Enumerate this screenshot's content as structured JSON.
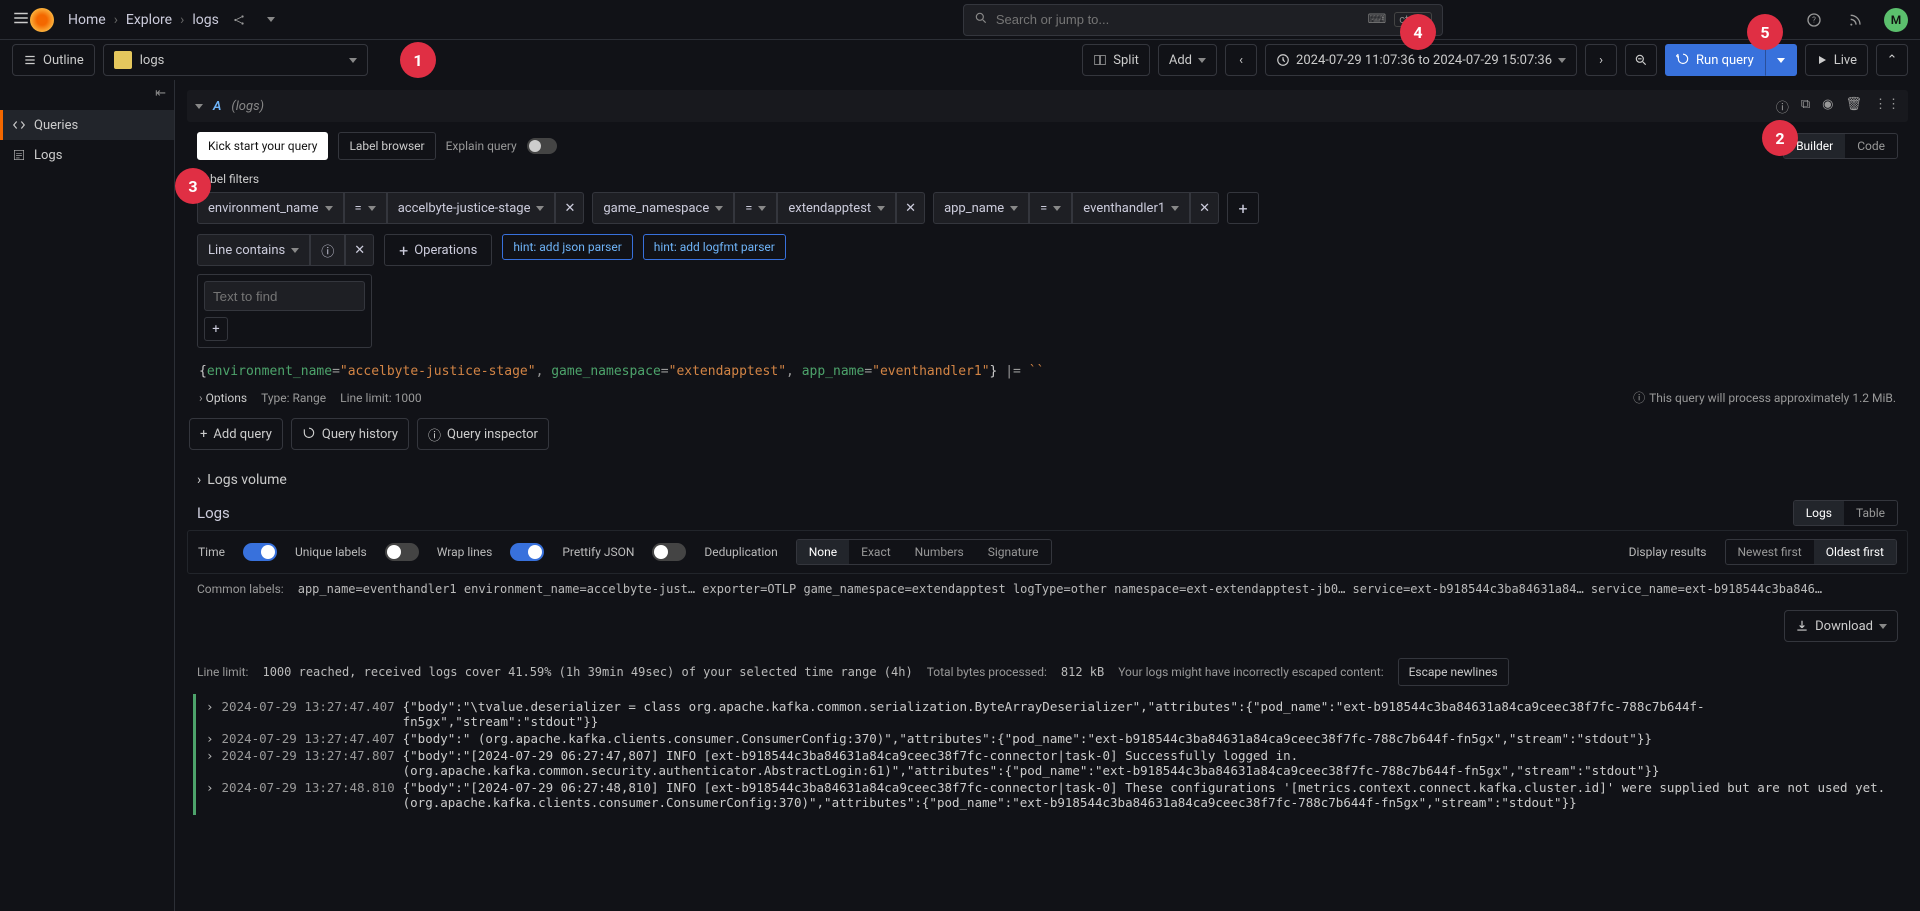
{
  "topnav": {
    "crumbs": [
      "Home",
      "Explore",
      "logs"
    ],
    "search_placeholder": "Search or jump to...",
    "kbd_hint": "ctrl+k",
    "avatar_initial": "M"
  },
  "toolbar": {
    "outline": "Outline",
    "datasource": "logs",
    "split": "Split",
    "add": "Add",
    "time_range": "2024-07-29 11:07:36 to 2024-07-29 15:07:36",
    "run": "Run query",
    "live": "Live"
  },
  "badges": {
    "b1": "1",
    "b2": "2",
    "b3": "3",
    "b4": "4",
    "b5": "5"
  },
  "sidebar": {
    "items": [
      "Queries",
      "Logs"
    ]
  },
  "query": {
    "letter": "A",
    "ds": "(logs)",
    "kick": "Kick start your query",
    "label_browser": "Label browser",
    "explain": "Explain query",
    "builder": "Builder",
    "code": "Code",
    "label_filters_title": "Label filters",
    "filters": [
      {
        "key": "environment_name",
        "op": "=",
        "val": "accelbyte-justice-stage"
      },
      {
        "key": "game_namespace",
        "op": "=",
        "val": "extendapptest"
      },
      {
        "key": "app_name",
        "op": "=",
        "val": "eventhandler1"
      }
    ],
    "line_contains": "Line contains",
    "text_to_find_ph": "Text to find",
    "operations": "Operations",
    "hint_json": "hint: add json parser",
    "hint_logfmt": "hint: add logfmt parser",
    "expr_parts": [
      {
        "t": "br",
        "v": "{"
      },
      {
        "t": "k",
        "v": "environment_name"
      },
      {
        "t": "op",
        "v": "="
      },
      {
        "t": "v",
        "v": "\"accelbyte-justice-stage\""
      },
      {
        "t": "op",
        "v": ", "
      },
      {
        "t": "k",
        "v": "game_namespace"
      },
      {
        "t": "op",
        "v": "="
      },
      {
        "t": "v",
        "v": "\"extendapptest\""
      },
      {
        "t": "op",
        "v": ", "
      },
      {
        "t": "k",
        "v": "app_name"
      },
      {
        "t": "op",
        "v": "="
      },
      {
        "t": "v",
        "v": "\"eventhandler1\""
      },
      {
        "t": "br",
        "v": "}"
      },
      {
        "t": "op",
        "v": " |= "
      },
      {
        "t": "v",
        "v": "``"
      }
    ],
    "options": "Options",
    "type": "Type: Range",
    "line_limit": "Line limit: 1000",
    "cost": "This query will process approximately 1.2 MiB.",
    "add_query": "Add query",
    "history": "Query history",
    "inspector": "Query inspector"
  },
  "results": {
    "volume": "Logs volume",
    "logs_title": "Logs",
    "tabs": {
      "logs": "Logs",
      "table": "Table"
    },
    "ctrl": {
      "time": "Time",
      "unique": "Unique labels",
      "wrap": "Wrap lines",
      "pretty": "Prettify JSON",
      "dedup": "Deduplication",
      "none": "None",
      "exact": "Exact",
      "numbers": "Numbers",
      "sig": "Signature",
      "display": "Display results",
      "newest": "Newest first",
      "oldest": "Oldest first"
    },
    "common_labels_lbl": "Common labels:",
    "common_labels": "app_name=eventhandler1  environment_name=accelbyte-just…  exporter=OTLP  game_namespace=extendapptest  logType=other  namespace=ext-extendapptest-jb0…  service=ext-b918544c3ba84631a84…  service_name=ext-b918544c3ba846…",
    "download": "Download",
    "line_limit_lbl": "Line limit:",
    "line_limit_val": "1000 reached, received logs cover 41.59% (1h 39min 49sec) of your selected time range (4h)",
    "bytes_lbl": "Total bytes processed:",
    "bytes_val": "812 kB",
    "escape_warn": "Your logs might have incorrectly escaped content:",
    "escape_btn": "Escape newlines",
    "lines": [
      {
        "ts": "2024-07-29 13:27:47.407",
        "body": "{\"body\":\"\\tvalue.deserializer = class org.apache.kafka.common.serialization.ByteArrayDeserializer\",\"attributes\":{\"pod_name\":\"ext-b918544c3ba84631a84ca9ceec38f7fc-788c7b644f-fn5gx\",\"stream\":\"stdout\"}}"
      },
      {
        "ts": "2024-07-29 13:27:47.407",
        "body": "{\"body\":\" (org.apache.kafka.clients.consumer.ConsumerConfig:370)\",\"attributes\":{\"pod_name\":\"ext-b918544c3ba84631a84ca9ceec38f7fc-788c7b644f-fn5gx\",\"stream\":\"stdout\"}}"
      },
      {
        "ts": "2024-07-29 13:27:47.807",
        "body": "{\"body\":\"[2024-07-29 06:27:47,807] INFO [ext-b918544c3ba84631a84ca9ceec38f7fc-connector|task-0] Successfully logged in. (org.apache.kafka.common.security.authenticator.AbstractLogin:61)\",\"attributes\":{\"pod_name\":\"ext-b918544c3ba84631a84ca9ceec38f7fc-788c7b644f-fn5gx\",\"stream\":\"stdout\"}}"
      },
      {
        "ts": "2024-07-29 13:27:48.810",
        "body": "{\"body\":\"[2024-07-29 06:27:48,810] INFO [ext-b918544c3ba84631a84ca9ceec38f7fc-connector|task-0] These configurations '[metrics.context.connect.kafka.cluster.id]' were supplied but are not used yet. (org.apache.kafka.clients.consumer.ConsumerConfig:370)\",\"attributes\":{\"pod_name\":\"ext-b918544c3ba84631a84ca9ceec38f7fc-788c7b644f-fn5gx\",\"stream\":\"stdout\"}}"
      }
    ]
  }
}
